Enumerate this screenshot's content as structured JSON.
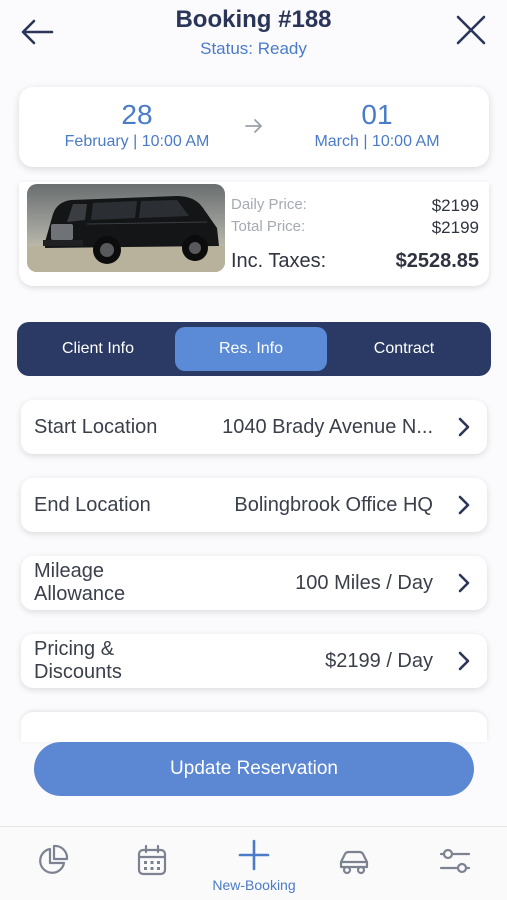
{
  "header": {
    "title": "Booking #188",
    "status": "Status: Ready"
  },
  "dates": {
    "start_day": "28",
    "start_sub": "February | 10:00 AM",
    "end_day": "01",
    "end_sub": "March | 10:00 AM"
  },
  "pricing": {
    "daily_label": "Daily Price:",
    "daily_value": "$2199",
    "total_label": "Total Price:",
    "total_value": "$2199",
    "taxes_label": "Inc. Taxes:",
    "taxes_value": "$2528.85"
  },
  "tabs": [
    {
      "label": "Client Info",
      "active": false
    },
    {
      "label": "Res. Info",
      "active": true
    },
    {
      "label": "Contract",
      "active": false
    }
  ],
  "rows": [
    {
      "label": "Start Location",
      "value": "1040 Brady Avenue N..."
    },
    {
      "label": "End Location",
      "value": "Bolingbrook Office HQ"
    },
    {
      "label_line1": "Mileage",
      "label_line2": "Allowance",
      "value": "100 Miles / Day"
    },
    {
      "label_line1": "Pricing &",
      "label_line2": "Discounts",
      "value": "$2199 / Day"
    }
  ],
  "update_button": "Update Reservation",
  "bottom_nav": {
    "new_booking_label": "New-Booking",
    "items": [
      "chart-pie-icon",
      "calendar-icon",
      "plus-icon",
      "car-icon",
      "sliders-icon"
    ]
  },
  "colors": {
    "navy": "#2a3a64",
    "accent": "#5b87d3",
    "text_blue": "#4a7bc8"
  }
}
